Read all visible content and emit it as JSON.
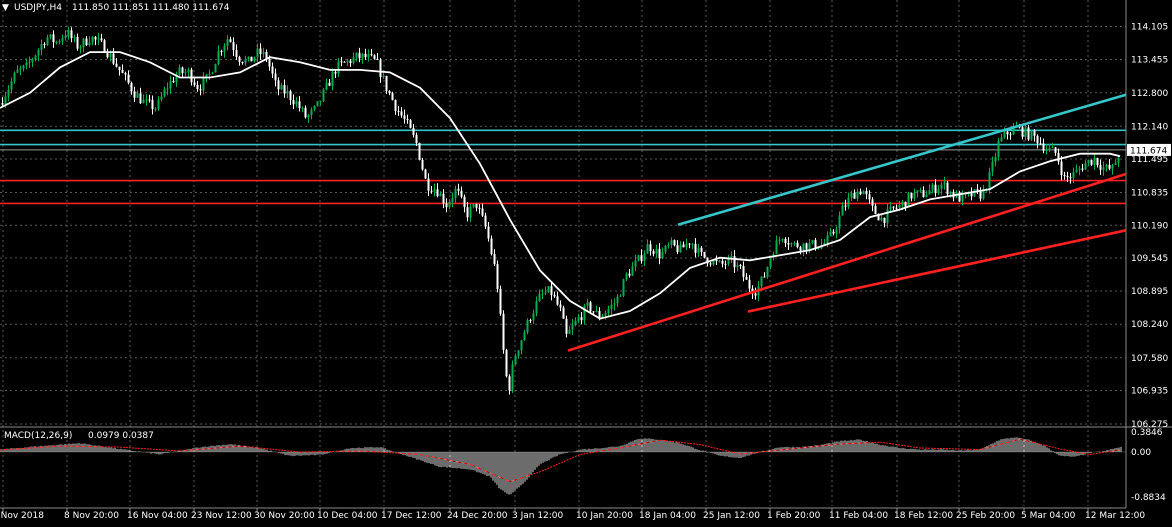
{
  "header": {
    "symbol_label": "USDJPY,H4",
    "ohlc": "111.850 111.851 111.480 111.674",
    "indicator_label": "MACD(12,26,9)",
    "indicator_values": "0.0979 0.0387"
  },
  "colors": {
    "background": "#000000",
    "grid": "#5a5a5a",
    "bull": "#00b050",
    "bear": "#ffffff",
    "ma": "#ffffff",
    "cyan_level": "#36c5c9",
    "red_level": "#ff2020",
    "macd_signal": "#ff2020",
    "macd_hist": "#d8d8d8",
    "price_box_bg": "#ffffff",
    "price_box_text": "#000000"
  },
  "chart_data": {
    "type": "candlestick",
    "symbol": "USDJPY",
    "timeframe": "H4",
    "current_price": "111.674",
    "y_ticks": [
      "114.105",
      "113.455",
      "112.800",
      "112.140",
      "111.495",
      "110.835",
      "110.190",
      "109.545",
      "108.895",
      "108.240",
      "107.580",
      "106.935",
      "106.275"
    ],
    "x_ticks": [
      "1 Nov 2018",
      "8 Nov 20:00",
      "16 Nov 04:00",
      "23 Nov 12:00",
      "30 Nov 20:00",
      "10 Dec 04:00",
      "17 Dec 12:00",
      "24 Dec 20:00",
      "3 Jan 12:00",
      "10 Jan 20:00",
      "18 Jan 04:00",
      "25 Jan 12:00",
      "1 Feb 20:00",
      "11 Feb 04:00",
      "18 Feb 12:00",
      "25 Feb 20:00",
      "5 Mar 04:00",
      "12 Mar 12:00"
    ],
    "close_path": [
      [
        0,
        112.6
      ],
      [
        8,
        112.9
      ],
      [
        16,
        113.2
      ],
      [
        26,
        113.3
      ],
      [
        36,
        113.6
      ],
      [
        46,
        113.9
      ],
      [
        56,
        113.8
      ],
      [
        66,
        114.0
      ],
      [
        78,
        113.7
      ],
      [
        90,
        113.9
      ],
      [
        104,
        113.7
      ],
      [
        114,
        113.4
      ],
      [
        124,
        113.1
      ],
      [
        134,
        112.8
      ],
      [
        144,
        112.6
      ],
      [
        156,
        112.5
      ],
      [
        166,
        112.9
      ],
      [
        178,
        113.2
      ],
      [
        188,
        113.2
      ],
      [
        198,
        112.9
      ],
      [
        208,
        113.1
      ],
      [
        218,
        113.6
      ],
      [
        228,
        113.9
      ],
      [
        238,
        113.5
      ],
      [
        248,
        113.4
      ],
      [
        258,
        113.6
      ],
      [
        266,
        113.5
      ],
      [
        276,
        112.9
      ],
      [
        286,
        112.8
      ],
      [
        296,
        112.6
      ],
      [
        306,
        112.3
      ],
      [
        316,
        112.5
      ],
      [
        326,
        112.9
      ],
      [
        336,
        113.3
      ],
      [
        346,
        113.4
      ],
      [
        356,
        113.5
      ],
      [
        366,
        113.5
      ],
      [
        376,
        113.4
      ],
      [
        386,
        112.9
      ],
      [
        396,
        112.5
      ],
      [
        406,
        112.2
      ],
      [
        416,
        111.8
      ],
      [
        426,
        111.0
      ],
      [
        436,
        110.9
      ],
      [
        446,
        110.6
      ],
      [
        456,
        110.9
      ],
      [
        466,
        110.4
      ],
      [
        476,
        110.6
      ],
      [
        486,
        110.1
      ],
      [
        496,
        109.2
      ],
      [
        504,
        107.5
      ],
      [
        508,
        106.9
      ],
      [
        514,
        107.6
      ],
      [
        522,
        108.0
      ],
      [
        530,
        108.4
      ],
      [
        540,
        108.8
      ],
      [
        550,
        108.9
      ],
      [
        560,
        108.5
      ],
      [
        566,
        108.0
      ],
      [
        576,
        108.3
      ],
      [
        588,
        108.6
      ],
      [
        598,
        108.4
      ],
      [
        606,
        108.5
      ],
      [
        616,
        108.7
      ],
      [
        626,
        109.2
      ],
      [
        638,
        109.5
      ],
      [
        648,
        109.8
      ],
      [
        660,
        109.6
      ],
      [
        670,
        109.8
      ],
      [
        680,
        109.7
      ],
      [
        690,
        109.9
      ],
      [
        700,
        109.6
      ],
      [
        710,
        109.5
      ],
      [
        720,
        109.4
      ],
      [
        730,
        109.5
      ],
      [
        740,
        109.3
      ],
      [
        748,
        109.0
      ],
      [
        756,
        108.9
      ],
      [
        764,
        109.2
      ],
      [
        772,
        109.7
      ],
      [
        782,
        110.0
      ],
      [
        792,
        109.8
      ],
      [
        802,
        109.8
      ],
      [
        812,
        109.8
      ],
      [
        822,
        109.8
      ],
      [
        832,
        110.0
      ],
      [
        842,
        110.5
      ],
      [
        852,
        110.8
      ],
      [
        862,
        110.9
      ],
      [
        872,
        110.5
      ],
      [
        882,
        110.3
      ],
      [
        892,
        110.5
      ],
      [
        902,
        110.6
      ],
      [
        912,
        110.8
      ],
      [
        922,
        110.8
      ],
      [
        932,
        110.9
      ],
      [
        942,
        111.0
      ],
      [
        952,
        110.8
      ],
      [
        962,
        110.7
      ],
      [
        972,
        110.8
      ],
      [
        982,
        110.8
      ],
      [
        990,
        111.2
      ],
      [
        998,
        111.8
      ],
      [
        1006,
        112.0
      ],
      [
        1016,
        112.1
      ],
      [
        1026,
        112.0
      ],
      [
        1036,
        111.9
      ],
      [
        1046,
        111.7
      ],
      [
        1056,
        111.6
      ],
      [
        1064,
        111.1
      ],
      [
        1074,
        111.2
      ],
      [
        1084,
        111.4
      ],
      [
        1094,
        111.5
      ],
      [
        1104,
        111.3
      ],
      [
        1112,
        111.3
      ],
      [
        1120,
        111.674
      ]
    ],
    "moving_average": [
      [
        0,
        112.5
      ],
      [
        30,
        112.8
      ],
      [
        60,
        113.3
      ],
      [
        90,
        113.6
      ],
      [
        120,
        113.6
      ],
      [
        150,
        113.4
      ],
      [
        180,
        113.1
      ],
      [
        210,
        113.1
      ],
      [
        240,
        113.2
      ],
      [
        270,
        113.5
      ],
      [
        300,
        113.4
      ],
      [
        330,
        113.25
      ],
      [
        360,
        113.25
      ],
      [
        390,
        113.2
      ],
      [
        420,
        112.9
      ],
      [
        450,
        112.3
      ],
      [
        480,
        111.4
      ],
      [
        510,
        110.3
      ],
      [
        540,
        109.3
      ],
      [
        570,
        108.7
      ],
      [
        600,
        108.35
      ],
      [
        630,
        108.5
      ],
      [
        660,
        108.85
      ],
      [
        690,
        109.35
      ],
      [
        720,
        109.55
      ],
      [
        750,
        109.5
      ],
      [
        780,
        109.6
      ],
      [
        810,
        109.7
      ],
      [
        840,
        109.9
      ],
      [
        870,
        110.35
      ],
      [
        900,
        110.5
      ],
      [
        930,
        110.7
      ],
      [
        960,
        110.8
      ],
      [
        990,
        110.9
      ],
      [
        1020,
        111.25
      ],
      [
        1050,
        111.45
      ],
      [
        1080,
        111.6
      ],
      [
        1110,
        111.6
      ],
      [
        1120,
        111.55
      ]
    ],
    "horizontal_lines": [
      {
        "color": "cyan",
        "price": 112.06
      },
      {
        "color": "cyan",
        "price": 111.78
      },
      {
        "color": "red",
        "price": 111.07
      },
      {
        "color": "red",
        "price": 110.62
      }
    ],
    "trend_lines": [
      {
        "color": "cyan",
        "from": [
          678,
          110.2
        ],
        "to": [
          1126,
          112.76
        ]
      },
      {
        "color": "red",
        "from": [
          568,
          107.72
        ],
        "to": [
          1126,
          111.2
        ]
      },
      {
        "color": "red",
        "from": [
          748,
          108.49
        ],
        "to": [
          1126,
          110.09
        ]
      }
    ],
    "macd": {
      "params": "12,26,9",
      "y_ticks": [
        "0.3846",
        "0.00",
        "-0.8834"
      ],
      "histogram": [
        [
          0,
          0.05
        ],
        [
          40,
          0.12
        ],
        [
          80,
          0.18
        ],
        [
          120,
          0.06
        ],
        [
          160,
          -0.05
        ],
        [
          200,
          0.1
        ],
        [
          230,
          0.16
        ],
        [
          260,
          0.08
        ],
        [
          290,
          -0.08
        ],
        [
          320,
          -0.06
        ],
        [
          350,
          0.08
        ],
        [
          380,
          0.1
        ],
        [
          410,
          -0.1
        ],
        [
          440,
          -0.3
        ],
        [
          470,
          -0.35
        ],
        [
          490,
          -0.5
        ],
        [
          500,
          -0.75
        ],
        [
          510,
          -0.88
        ],
        [
          525,
          -0.6
        ],
        [
          540,
          -0.25
        ],
        [
          560,
          -0.05
        ],
        [
          580,
          0.05
        ],
        [
          600,
          0.08
        ],
        [
          620,
          0.12
        ],
        [
          640,
          0.28
        ],
        [
          660,
          0.25
        ],
        [
          680,
          0.18
        ],
        [
          700,
          0.04
        ],
        [
          720,
          -0.08
        ],
        [
          740,
          -0.12
        ],
        [
          760,
          0.0
        ],
        [
          780,
          0.1
        ],
        [
          800,
          0.1
        ],
        [
          820,
          0.14
        ],
        [
          840,
          0.22
        ],
        [
          860,
          0.25
        ],
        [
          880,
          0.15
        ],
        [
          900,
          0.08
        ],
        [
          920,
          0.05
        ],
        [
          940,
          0.05
        ],
        [
          960,
          0.03
        ],
        [
          980,
          0.05
        ],
        [
          1000,
          0.25
        ],
        [
          1015,
          0.3
        ],
        [
          1030,
          0.24
        ],
        [
          1045,
          0.12
        ],
        [
          1060,
          -0.08
        ],
        [
          1075,
          -0.1
        ],
        [
          1090,
          -0.02
        ],
        [
          1105,
          0.02
        ],
        [
          1120,
          0.1
        ]
      ],
      "signal": [
        [
          0,
          0.04
        ],
        [
          60,
          0.12
        ],
        [
          120,
          0.1
        ],
        [
          180,
          0.02
        ],
        [
          240,
          0.12
        ],
        [
          300,
          0.0
        ],
        [
          360,
          0.02
        ],
        [
          420,
          -0.05
        ],
        [
          470,
          -0.25
        ],
        [
          510,
          -0.6
        ],
        [
          540,
          -0.4
        ],
        [
          580,
          -0.05
        ],
        [
          620,
          0.08
        ],
        [
          660,
          0.24
        ],
        [
          700,
          0.15
        ],
        [
          740,
          -0.04
        ],
        [
          780,
          0.04
        ],
        [
          840,
          0.16
        ],
        [
          880,
          0.2
        ],
        [
          920,
          0.08
        ],
        [
          980,
          0.05
        ],
        [
          1020,
          0.26
        ],
        [
          1060,
          0.06
        ],
        [
          1090,
          -0.05
        ],
        [
          1120,
          0.04
        ]
      ]
    }
  }
}
